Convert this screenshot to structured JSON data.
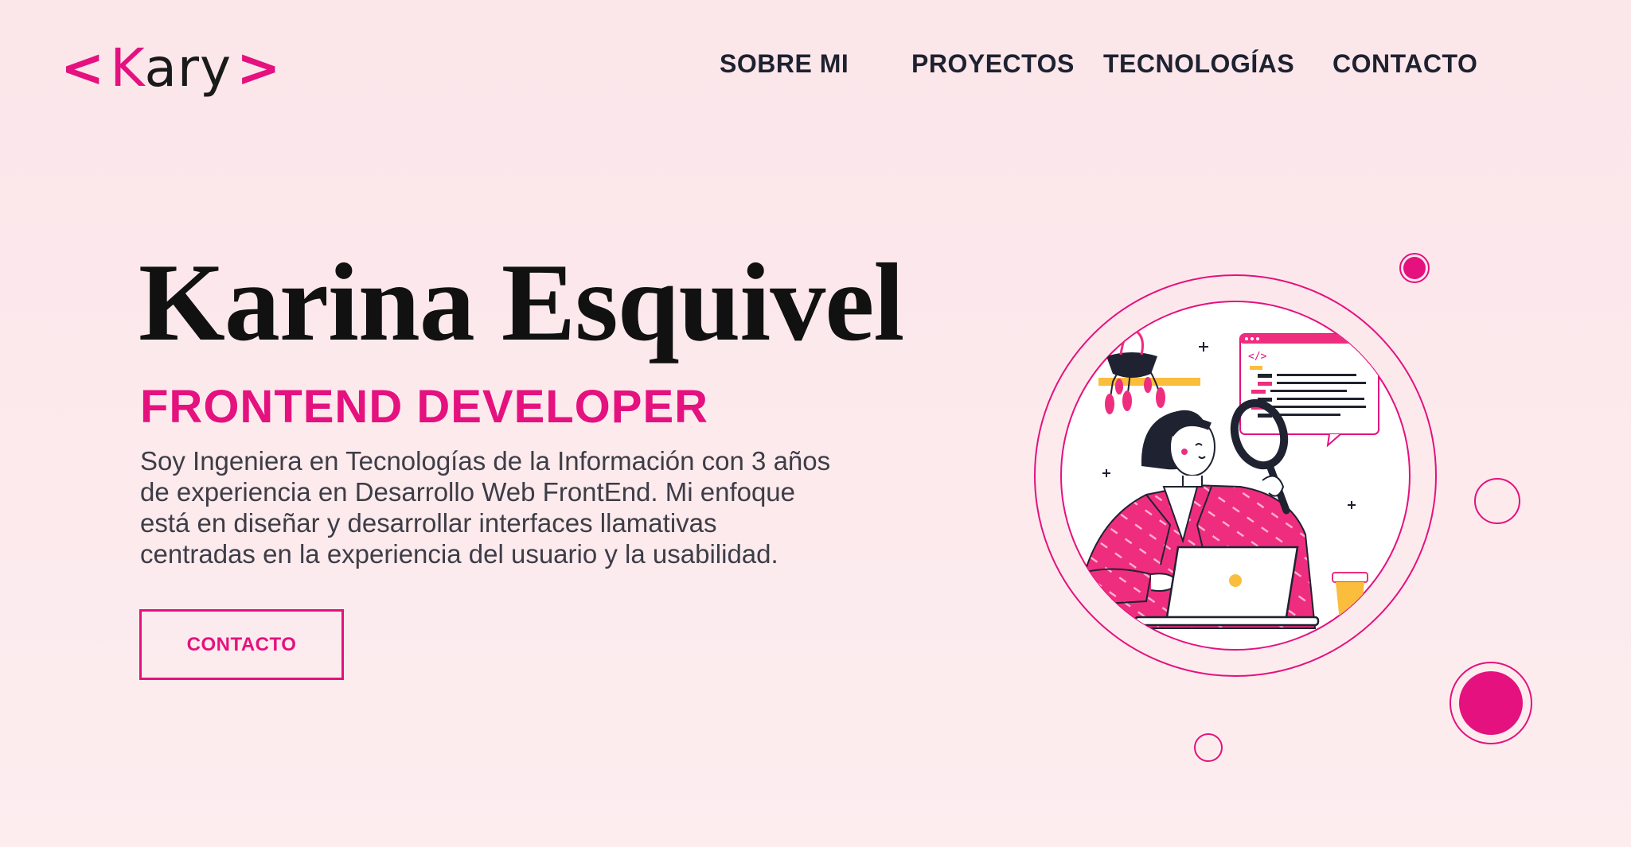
{
  "header": {
    "logo": {
      "open": "<",
      "close": ">",
      "first_letter": "K",
      "rest": "ary"
    },
    "nav": [
      {
        "label": "SOBRE MI"
      },
      {
        "label": "PROYECTOS"
      },
      {
        "label": "TECNOLOGÍAS"
      },
      {
        "label": "CONTACTO"
      }
    ]
  },
  "hero": {
    "name": "Karina Esquivel",
    "role": "FRONTEND DEVELOPER",
    "description_lines": [
      "Soy Ingeniera en Tecnologías de la Información con 3 años",
      "de experiencia en Desarrollo Web FrontEnd. Mi enfoque",
      "está en diseñar y desarrollar interfaces llamativas",
      "centradas en la experiencia del usuario y la usabilidad."
    ],
    "cta_label": "CONTACTO"
  },
  "illustration": {
    "code_tag": "</>",
    "icons": [
      "woman-developer-illustration",
      "magnifier-icon",
      "laptop-icon",
      "plant-icon",
      "code-window-icon",
      "coffee-cup-icon",
      "sparkle-icon"
    ]
  },
  "colors": {
    "accent": "#e4117f",
    "background": "#fbe6ea",
    "text": "#1f2230",
    "yellow": "#fbbd3c"
  }
}
